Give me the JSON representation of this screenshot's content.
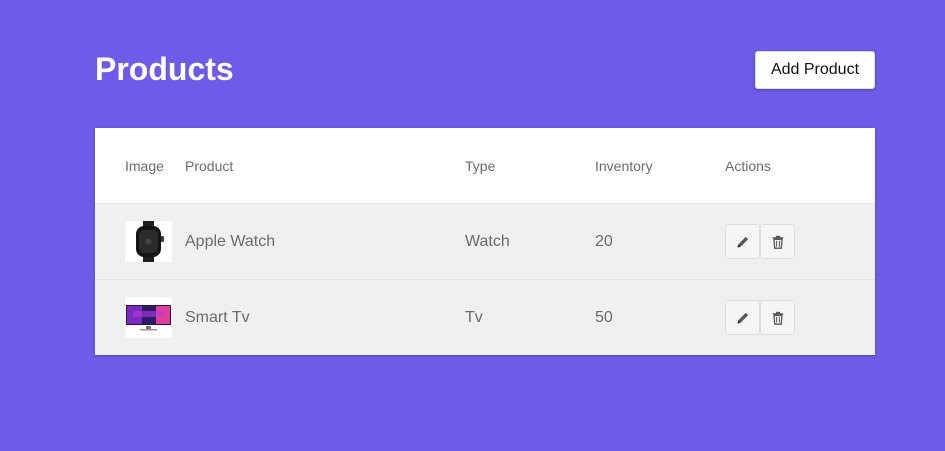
{
  "header": {
    "title": "Products",
    "add_button_label": "Add Product"
  },
  "table": {
    "columns": {
      "image": "Image",
      "product": "Product",
      "type": "Type",
      "inventory": "Inventory",
      "actions": "Actions"
    },
    "rows": [
      {
        "product": "Apple Watch",
        "type": "Watch",
        "inventory": "20",
        "image_icon": "apple-watch-icon"
      },
      {
        "product": "Smart Tv",
        "type": "Tv",
        "inventory": "50",
        "image_icon": "smart-tv-icon"
      }
    ]
  },
  "colors": {
    "background": "#6c5ce7",
    "card": "#ffffff",
    "row_background": "#f1f0f0",
    "muted_text": "#6b6b6b"
  },
  "icons": {
    "edit": "pencil-icon",
    "delete": "trash-icon"
  }
}
